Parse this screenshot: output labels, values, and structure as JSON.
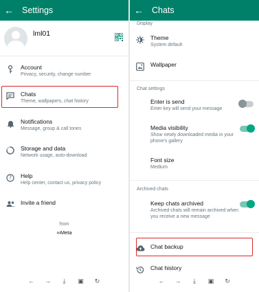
{
  "left": {
    "appbar": {
      "title": "Settings"
    },
    "profile": {
      "name": "lml01"
    },
    "items": [
      {
        "title": "Account",
        "subtitle": "Privacy, security, change number"
      },
      {
        "title": "Chats",
        "subtitle": "Theme, wallpapers, chat history"
      },
      {
        "title": "Notifications",
        "subtitle": "Message, group & call tones"
      },
      {
        "title": "Storage and data",
        "subtitle": "Network usage, auto-download"
      },
      {
        "title": "Help",
        "subtitle": "Help center, contact us, privacy policy"
      },
      {
        "title": "Invite a friend",
        "subtitle": ""
      }
    ],
    "footer": {
      "from": "from",
      "brand": "∞Meta"
    },
    "navbar": [
      "←",
      "→",
      "⤓",
      "▣",
      "↻"
    ]
  },
  "right": {
    "appbar": {
      "title": "Chats"
    },
    "sections": {
      "display": "Display",
      "chat_settings": "Chat settings",
      "archived": "Archived chats"
    },
    "theme": {
      "title": "Theme",
      "subtitle": "System default"
    },
    "wallpaper": {
      "title": "Wallpaper"
    },
    "enter_is_send": {
      "title": "Enter is send",
      "subtitle": "Enter key will send your message",
      "enabled": false
    },
    "media_visibility": {
      "title": "Media visibility",
      "subtitle": "Show newly downloaded media in your phone's gallery",
      "enabled": true
    },
    "font_size": {
      "title": "Font size",
      "subtitle": "Medium"
    },
    "keep_archived": {
      "title": "Keep chats archived",
      "subtitle": "Archived chats will remain archived when you receive a new message",
      "enabled": true
    },
    "chat_backup": {
      "title": "Chat backup"
    },
    "chat_history": {
      "title": "Chat history"
    },
    "navbar": [
      "←",
      "→",
      "⤓",
      "▣",
      "↻"
    ]
  },
  "colors": {
    "accent": "#008069",
    "toggle_on": "#00a884",
    "highlight": "#d9262c",
    "secondary_text": "#667781"
  }
}
